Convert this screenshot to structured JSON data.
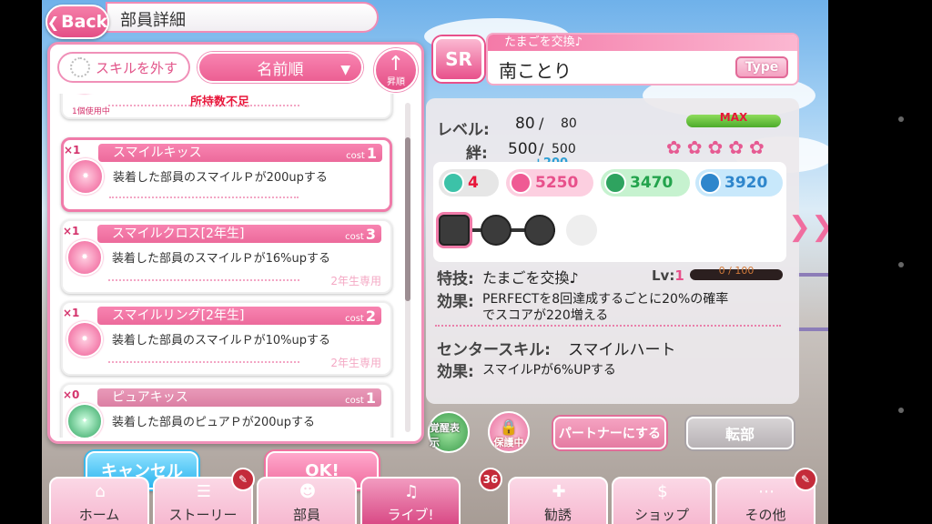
{
  "header": {
    "back_label": "Back",
    "title": "部員詳細"
  },
  "skill_panel": {
    "remove_skill_label": "スキルを外す",
    "sort_label": "名前順",
    "ascending_label": "昇順",
    "partial_top": {
      "using_label": "1個使用中",
      "status": "所持数不足"
    },
    "skills": [
      {
        "count": "×1",
        "name": "スマイルキッス",
        "cost_label": "cost",
        "cost": "1",
        "description": "装着した部員のスマイルＰが200upする",
        "restriction": ""
      },
      {
        "count": "×1",
        "name": "スマイルクロス[2年生]",
        "cost_label": "cost",
        "cost": "3",
        "description": "装着した部員のスマイルＰが16%upする",
        "restriction": "2年生専用"
      },
      {
        "count": "×1",
        "name": "スマイルリング[2年生]",
        "cost_label": "cost",
        "cost": "2",
        "description": "装着した部員のスマイルＰが10%upする",
        "restriction": "2年生専用"
      },
      {
        "count": "×0",
        "name": "ピュアキッス",
        "cost_label": "cost",
        "cost": "1",
        "description": "装着した部員のピュアＰが200upする",
        "restriction": ""
      }
    ]
  },
  "footer_buttons": {
    "cancel_label": "キャンセル",
    "ok_label": "OK!"
  },
  "member": {
    "rarity": "SR",
    "title": "たまごを交換♪",
    "name": "南ことり",
    "type_label": "Type",
    "level_label": "レベル:",
    "level": "80",
    "level_max": "80",
    "max_label": "MAX",
    "bond_label": "絆:",
    "bond": "500",
    "bond_max": "500",
    "stats": {
      "kizuna": "4",
      "smile": "5250",
      "pure": "3470",
      "cool": "3920",
      "bonus": "+200"
    },
    "skill_label": "特技:",
    "skill_name": "たまごを交換♪",
    "skill_level_label": "Lv:",
    "skill_level": "1",
    "skill_exp": "0 / 100",
    "effect_label": "効果:",
    "effect_line1": "PERFECTを8回達成するごとに20%の確率",
    "effect_line2": "でスコアが220増える",
    "center_label": "センタースキル:",
    "center_name": "スマイルハート",
    "center_effect": "スマイルPが6%UP する",
    "center_effect_text": "スマイルPが6%UPする"
  },
  "actions": {
    "awaken_label": "覚醒表示",
    "protect_label": "保護中",
    "partner_label": "パートナーにする",
    "transfer_label": "転部"
  },
  "nav": {
    "tabs": [
      "ホーム",
      "ストーリー",
      "部員",
      "ライブ!",
      "勧誘",
      "ショップ",
      "その他"
    ],
    "live_badge": "36"
  },
  "colors": {
    "accent_pink": "#f07ba9",
    "smile": "#e8508b",
    "pure": "#23a34c",
    "cool": "#2e86cc",
    "cancel_blue": "#2ab4ee"
  },
  "icons": [
    "back-icon",
    "ascending-arrow-icon",
    "smile-gem-icon",
    "pure-gem-icon",
    "heart-icon",
    "flower-icon",
    "lock-icon",
    "house-icon",
    "book-icon",
    "note-icon",
    "person-add-icon",
    "dollar-icon",
    "pen-icon"
  ]
}
